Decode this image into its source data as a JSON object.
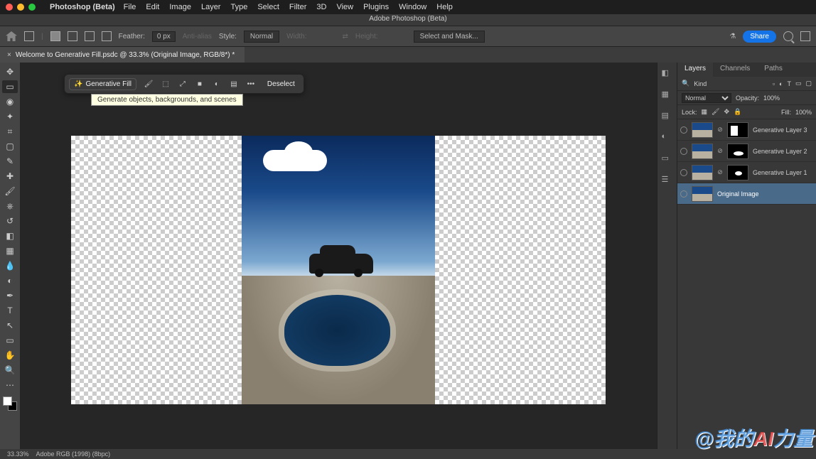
{
  "menubar": {
    "apple": "",
    "app": "Photoshop (Beta)",
    "items": [
      "File",
      "Edit",
      "Image",
      "Layer",
      "Type",
      "Select",
      "Filter",
      "3D",
      "View",
      "Plugins",
      "Window",
      "Help"
    ]
  },
  "title": "Adobe Photoshop (Beta)",
  "optbar": {
    "feather_label": "Feather:",
    "feather_value": "0 px",
    "antialias": "Anti-alias",
    "style_label": "Style:",
    "style_value": "Normal",
    "width_label": "Width:",
    "height_label": "Height:",
    "selectmask": "Select and Mask...",
    "share": "Share"
  },
  "doc": {
    "close": "×",
    "name": "Welcome to Generative Fill.psdc @ 33.3% (Original Image, RGB/8*) *"
  },
  "ctb": {
    "genfill": "Generative Fill",
    "dots": "•••",
    "deselect": "Deselect"
  },
  "tooltip": "Generate objects, backgrounds, and scenes",
  "panel": {
    "tabs": [
      "Layers",
      "Channels",
      "Paths"
    ],
    "kind_label": "Kind",
    "blend": "Normal",
    "opacity_label": "Opacity:",
    "opacity_value": "100%",
    "lock_label": "Lock:",
    "fill_label": "Fill:",
    "fill_value": "100%",
    "layers": [
      {
        "name": "Generative Layer 3"
      },
      {
        "name": "Generative Layer 2"
      },
      {
        "name": "Generative Layer 1"
      },
      {
        "name": "Original Image"
      }
    ]
  },
  "status": {
    "zoom": "33.33%",
    "info": "Adobe RGB (1998) (8bpc)"
  },
  "watermark": {
    "pre": "@我的",
    "ai": "AI",
    "post": "力量"
  }
}
